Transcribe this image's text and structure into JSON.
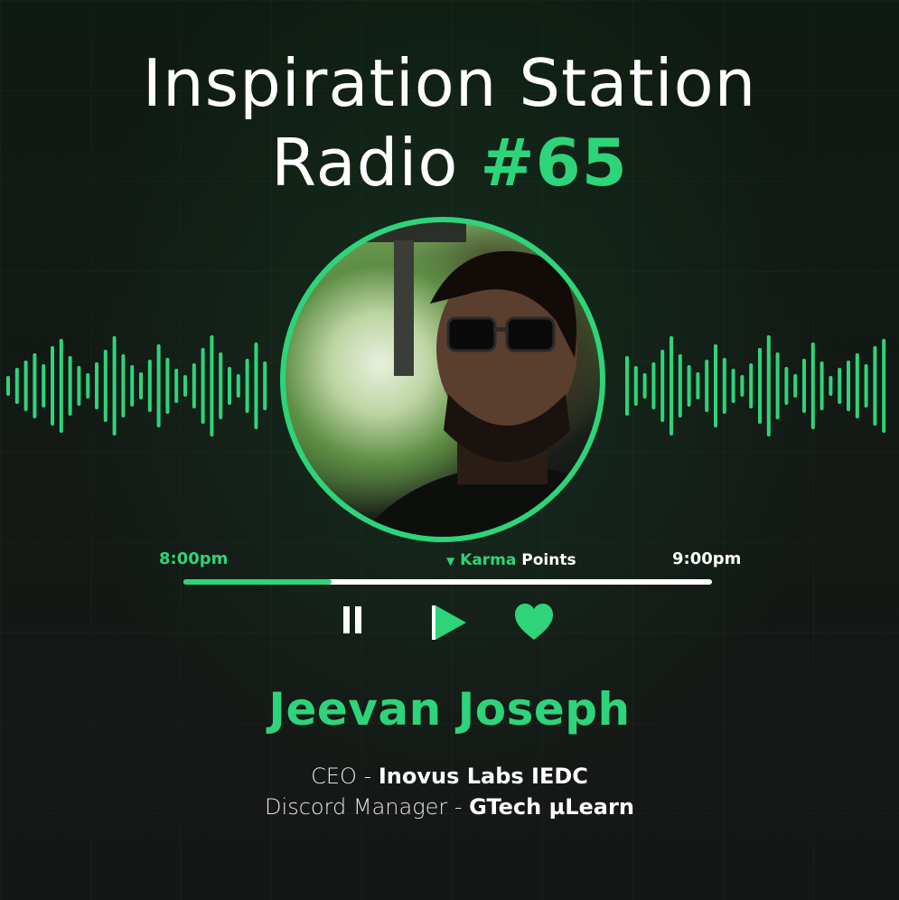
{
  "title": {
    "line1": "Inspiration Station",
    "line2_text": "Radio",
    "line2_accent": "#65"
  },
  "player": {
    "start_time": "8:00pm",
    "end_time": "9:00pm",
    "marker_label_highlight": "Karma",
    "marker_label_rest": "Points",
    "progress": 0.28
  },
  "guest": {
    "name": "Jeevan Joseph",
    "role1_title": "CEO - ",
    "role1_org": "Inovus Labs IEDC",
    "role2_title": "Discord Manager - ",
    "role2_org": "GTech µLearn"
  },
  "colors": {
    "accent": "#2ed47a",
    "background": "#121713",
    "text": "#ffffff"
  },
  "icons": [
    "pause-icon",
    "play-icon",
    "heart-icon",
    "sound-wave-icon"
  ]
}
